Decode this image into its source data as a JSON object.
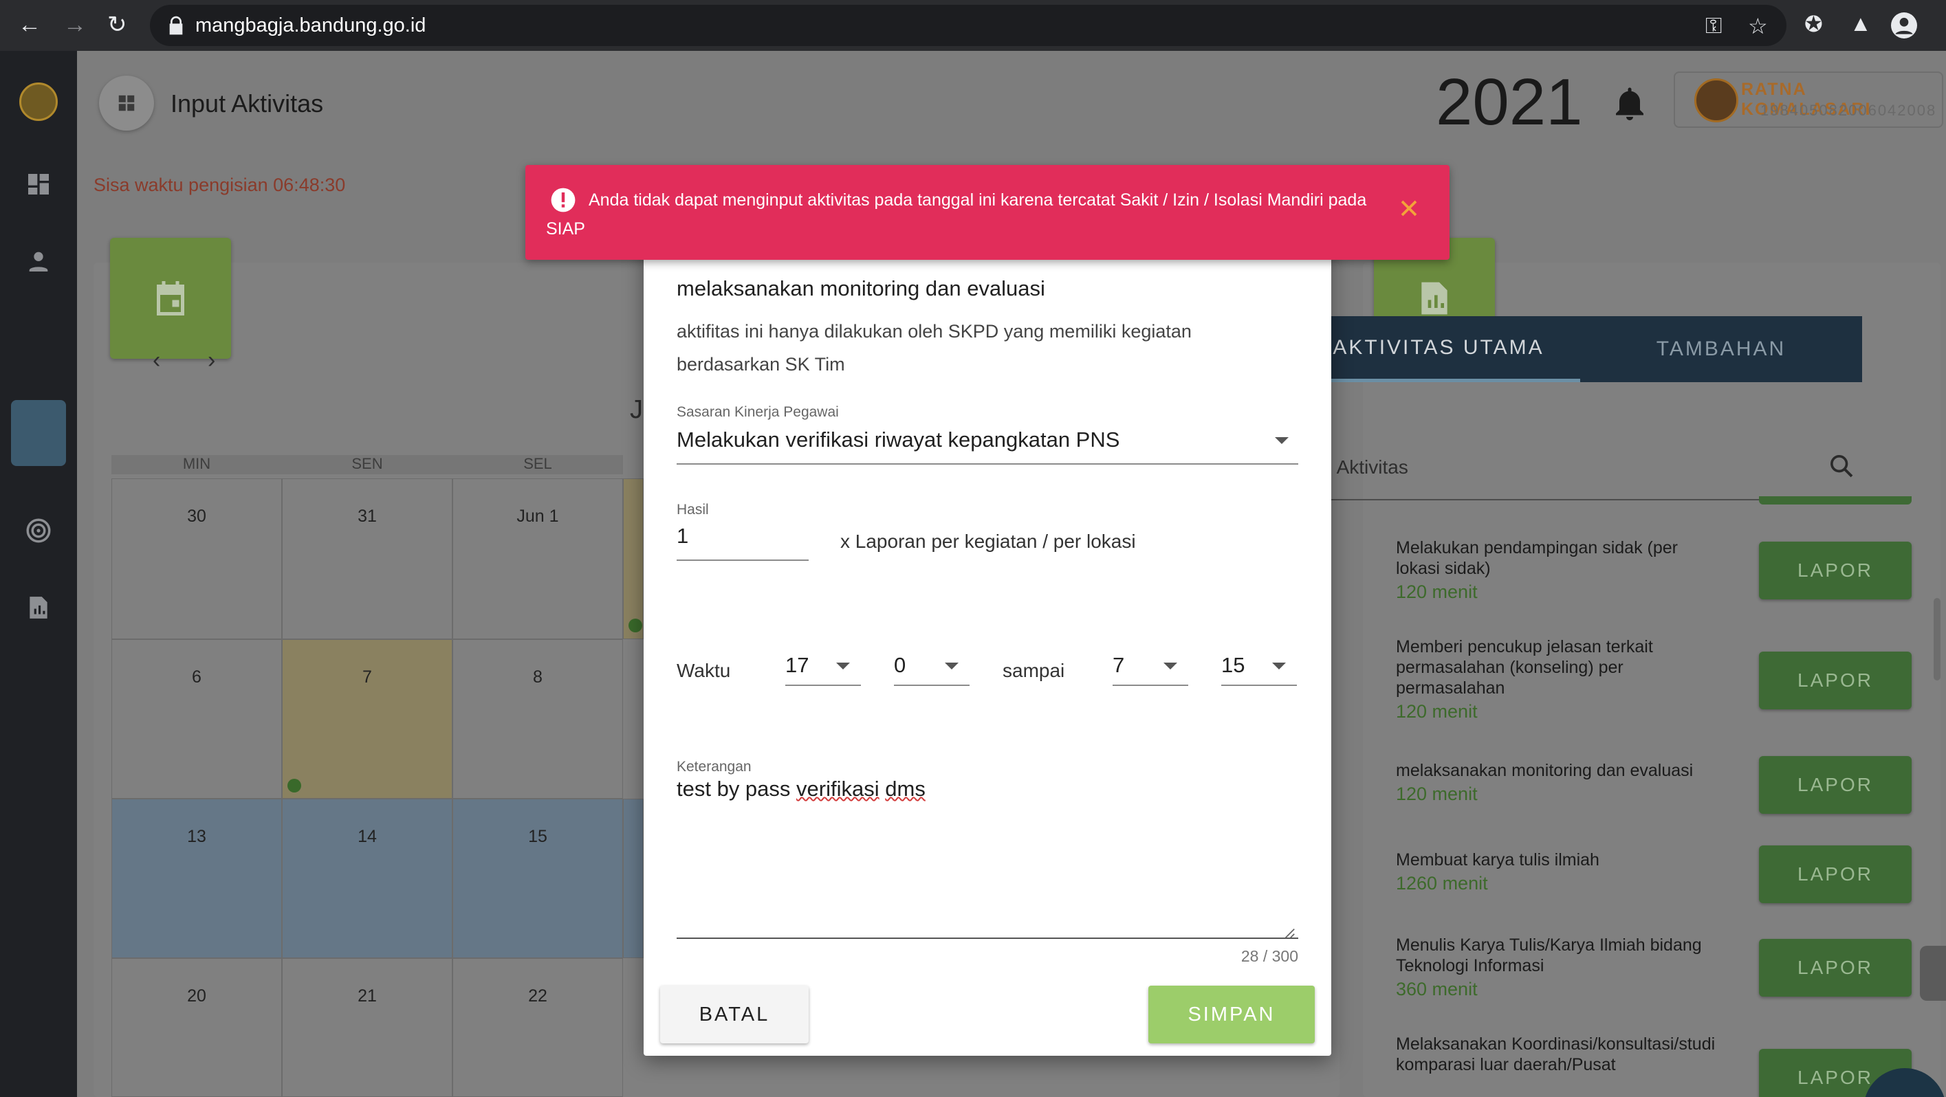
{
  "browser": {
    "url": "mangbagja.bandung.go.id"
  },
  "header": {
    "title": "Input Aktivitas",
    "year": "2021",
    "user_name": "RATNA KOMALASARI",
    "user_nip": "198405082006042008"
  },
  "countdown": "Sisa waktu pengisian 06:48:30",
  "calendar": {
    "month_initial": "J",
    "day_headers": [
      "MIN",
      "SEN",
      "SEL"
    ],
    "rows": [
      [
        "30",
        "31",
        "Jun 1"
      ],
      [
        "6",
        "7",
        "8"
      ],
      [
        "13",
        "14",
        "15"
      ],
      [
        "20",
        "21",
        "22"
      ]
    ]
  },
  "alert": {
    "message": "Anda tidak dapat menginput aktivitas pada tanggal ini karena tercatat Sakit / Izin / Isolasi Mandiri pada SIAP"
  },
  "modal": {
    "title": "melaksanakan monitoring dan evaluasi",
    "description": "aktifitas ini hanya dilakukan oleh SKPD yang memiliki kegiatan berdasarkan SK Tim",
    "sasaran_label": "Sasaran Kinerja Pegawai",
    "sasaran_value": "Melakukan verifikasi riwayat kepangkatan PNS",
    "hasil_label": "Hasil",
    "hasil_value": "1",
    "hasil_unit": "x Laporan per kegiatan / per lokasi",
    "waktu_label": "Waktu",
    "start_hour": "17",
    "start_minute": "0",
    "sampai_label": "sampai",
    "end_hour": "7",
    "end_minute": "15",
    "keterangan_label": "Keterangan",
    "keterangan_value_plain": "test by pass ",
    "keterangan_value_spell1": "verifikasi",
    "keterangan_value_space": " ",
    "keterangan_value_spell2": "dms",
    "counter": "28 / 300",
    "cancel_label": "BATAL",
    "save_label": "SIMPAN"
  },
  "activities_panel": {
    "tab_main": "AKTIVITAS UTAMA",
    "tab_extra": "TAMBAHAN",
    "search_placeholder": "Cari Aktivitas",
    "report_label": "LAPOR",
    "items": [
      {
        "name": "Melakukan pendampingan sidak (per lokasi sidak)",
        "duration": "120 menit"
      },
      {
        "name": "Memberi pencukup jelasan terkait permasalahan (konseling) per permasalahan",
        "duration": "120 menit"
      },
      {
        "name": "melaksanakan monitoring dan evaluasi",
        "duration": "120 menit"
      },
      {
        "name": "Membuat karya tulis ilmiah",
        "duration": "1260 menit"
      },
      {
        "name": "Menulis Karya Tulis/Karya Ilmiah bidang Teknologi Informasi",
        "duration": "360 menit"
      },
      {
        "name": "Melaksanakan Koordinasi/konsultasi/studi komparasi luar daerah/Pusat",
        "duration": ""
      }
    ]
  },
  "colors": {
    "alert_bg": "#e12d5a",
    "primary_green": "#9ccd6a",
    "tab_bg": "#1e3040",
    "countdown_text": "#8a3b2b"
  }
}
